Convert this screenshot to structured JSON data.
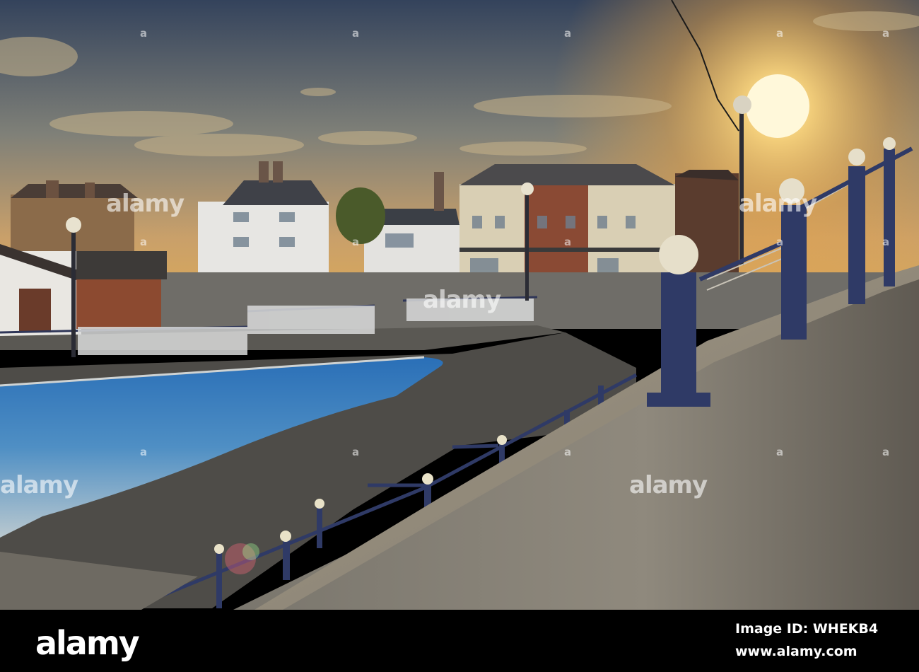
{
  "watermark": {
    "text": "alamy",
    "tile_text": "a"
  },
  "footer": {
    "brand": "alamy",
    "image_id": "Image ID: WHEKB4",
    "site": "www.alamy.com"
  },
  "scene": {
    "palette": {
      "sky_top": "#3a4a63",
      "sky_mid": "#8b8a7a",
      "sky_glow": "#f2b54a",
      "sun": "#fff3c2",
      "water": "#2f74b8",
      "wall": "#8a857a",
      "railing": "#2f3a66",
      "pavement": "#4a4946"
    }
  }
}
